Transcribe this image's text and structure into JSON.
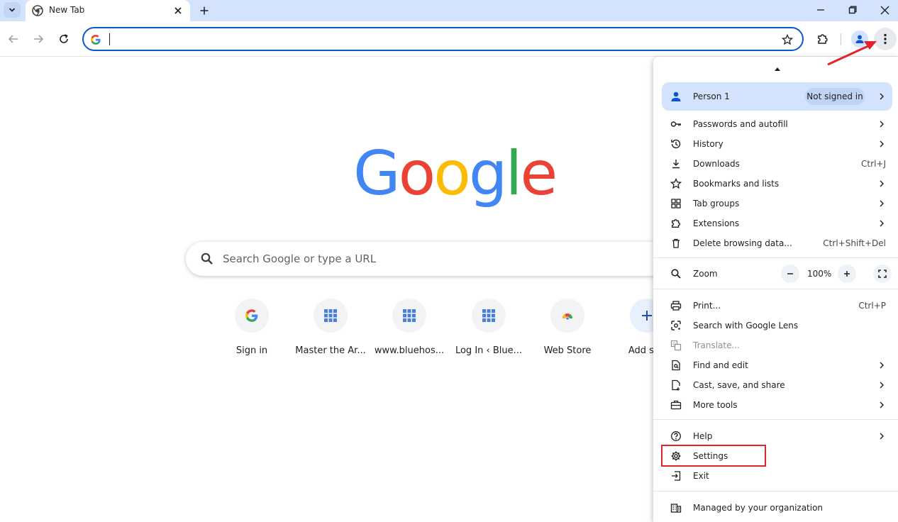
{
  "browser": {
    "tab": {
      "title": "New Tab"
    },
    "omnibox": {
      "value": ""
    }
  },
  "ntp": {
    "search_placeholder": "Search Google or type a URL",
    "shortcuts": [
      {
        "label": "Sign in",
        "icon": "google-g-icon"
      },
      {
        "label": "Master the Ar...",
        "icon": "grid-icon"
      },
      {
        "label": "www.bluehos...",
        "icon": "grid-icon"
      },
      {
        "label": "Log In ‹ Blue...",
        "icon": "grid-icon"
      },
      {
        "label": "Web Store",
        "icon": "web-store-icon"
      },
      {
        "label": "Add sho",
        "icon": "plus-icon"
      }
    ]
  },
  "menu": {
    "person": {
      "label": "Person 1",
      "badge": "Not signed in"
    },
    "items": {
      "passwords": "Passwords and autofill",
      "history": "History",
      "downloads": "Downloads",
      "downloads_shortcut": "Ctrl+J",
      "bookmarks": "Bookmarks and lists",
      "tab_groups": "Tab groups",
      "extensions": "Extensions",
      "delete_data": "Delete browsing data...",
      "delete_data_shortcut": "Ctrl+Shift+Del",
      "zoom": "Zoom",
      "zoom_value": "100%",
      "print": "Print...",
      "print_shortcut": "Ctrl+P",
      "lens": "Search with Google Lens",
      "translate": "Translate...",
      "find_edit": "Find and edit",
      "cast": "Cast, save, and share",
      "more_tools": "More tools",
      "help": "Help",
      "settings": "Settings",
      "exit": "Exit",
      "managed": "Managed by your organization"
    }
  },
  "colors": {
    "accent": "#0b57d0",
    "highlight": "#e0242c",
    "google_blue": "#4285f4",
    "google_red": "#ea4335",
    "google_yellow": "#fbbc05",
    "google_green": "#34a853"
  }
}
